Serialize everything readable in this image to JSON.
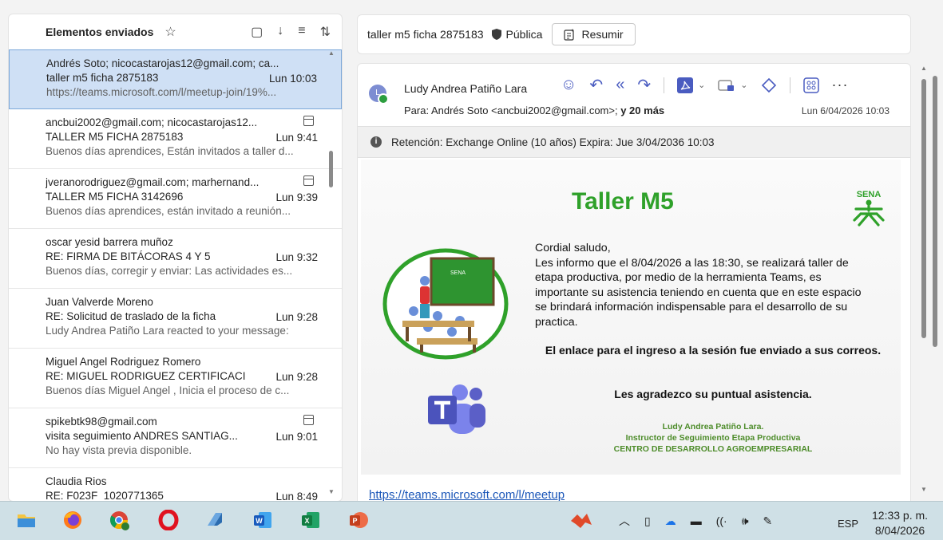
{
  "list": {
    "folder_title": "Elementos enviados",
    "items": [
      {
        "from": "Andrés Soto; nicocastarojas12@gmail.com; ca...",
        "subject": "taller m5 ficha 2875183",
        "time": "Lun 10:03",
        "preview": "https://teams.microsoft.com/l/meetup-join/19%...",
        "selected": true,
        "calendar": false
      },
      {
        "from": "ancbui2002@gmail.com; nicocastarojas12...",
        "subject": "TALLER M5 FICHA 2875183",
        "time": "Lun 9:41",
        "preview": "Buenos días aprendices, Están invitados a taller d...",
        "selected": false,
        "calendar": true
      },
      {
        "from": "jveranorodriguez@gmail.com; marhernand...",
        "subject": "TALLER M5 FICHA 3142696",
        "time": "Lun 9:39",
        "preview": "Buenos días aprendices, están invitado a reunión...",
        "selected": false,
        "calendar": true
      },
      {
        "from": "oscar yesid barrera muñoz",
        "subject": "RE: FIRMA DE BITÁCORAS 4 Y 5",
        "time": "Lun 9:32",
        "preview": "Buenos días, corregir y enviar: Las actividades es...",
        "selected": false,
        "calendar": false
      },
      {
        "from": "Juan Valverde Moreno",
        "subject": "RE: Solicitud de traslado de la ficha",
        "time": "Lun 9:28",
        "preview": "Ludy Andrea Patiño Lara reacted to your message:",
        "selected": false,
        "calendar": false
      },
      {
        "from": "Miguel Angel Rodriguez Romero",
        "subject": "RE: MIGUEL RODRIGUEZ CERTIFICACI...",
        "time": "Lun 9:28",
        "preview": "Buenos días Miguel Angel , Inicia el proceso de c...",
        "selected": false,
        "calendar": false
      },
      {
        "from": "spikebtk98@gmail.com",
        "subject": "visita seguimiento ANDRES SANTIAG...",
        "time": "Lun 9:01",
        "preview": "No hay vista previa disponible.",
        "selected": false,
        "calendar": true
      },
      {
        "from": "Claudia Rios",
        "subject": "RE: F023F_1020771365",
        "time": "Lun 8:49",
        "preview": "",
        "selected": false,
        "calendar": false
      }
    ]
  },
  "reader": {
    "subject": "taller m5 ficha 2875183",
    "visibility": "Pública",
    "summarize_label": "Resumir",
    "avatar_initial": "L",
    "sender": "Ludy Andrea Patiño Lara",
    "to_prefix": "Para: Andrés Soto <ancbui2002@gmail.com>;",
    "to_more": "y 20 más",
    "date": "Lun 6/04/2026 10:03",
    "retention": "Retención: Exchange Online (10 años) Expira: Jue 3/04/2036 10:03",
    "link_text": "https://teams.microsoft.com/l/meetup"
  },
  "flyer": {
    "title": "Taller M5",
    "sena_label": "SENA",
    "body_lines": [
      "Cordial saludo,",
      "Les informo que el 8/04/2026 a las 18:30, se realizará taller de",
      "etapa productiva, por medio de la  herramienta Teams, es",
      "importante su asistencia teniendo en cuenta que en este espacio",
      "se brindará información indispensable para el desarrollo de su",
      "practica."
    ],
    "link_note": "El enlace para el ingreso a la sesión fue  enviado a sus correos.",
    "thanks": "Les agradezco su puntual asistencia.",
    "signature_name": "Ludy Andrea Patiño Lara.",
    "signature_role": "Instructor de Seguimiento Etapa Productiva",
    "signature_center": "CENTRO DE DESARROLLO AGROEMPRESARIAL"
  },
  "taskbar": {
    "language": "ESP",
    "time": "12:33 p. m.",
    "date": "8/04/2026"
  },
  "colors": {
    "accent": "#4a5cc0",
    "selected_bg": "#cfe0f5",
    "flyer_green": "#2fa12a",
    "taskbar_bg": "#cfe0e6"
  }
}
